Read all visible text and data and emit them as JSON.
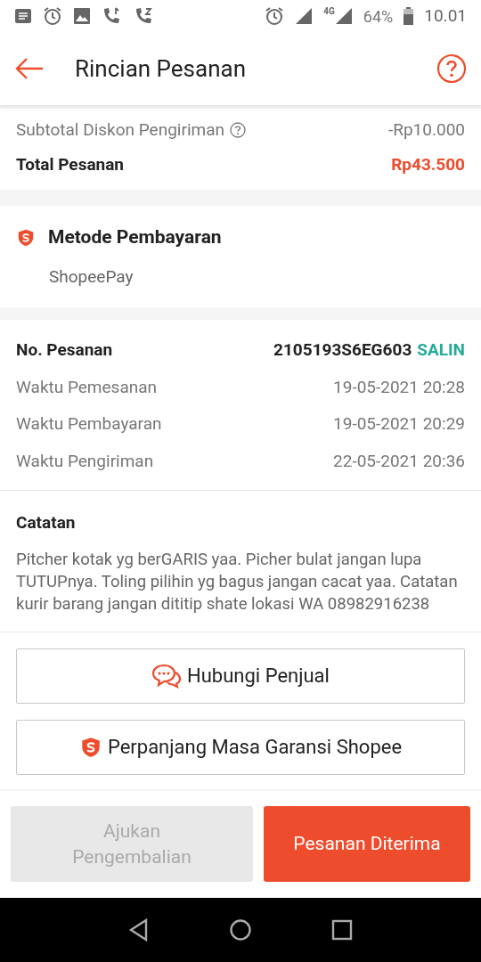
{
  "status_bar": {
    "network": "4G",
    "battery": "64%",
    "time": "10.01"
  },
  "header": {
    "title": "Rincian Pesanan"
  },
  "summary": [
    {
      "label": "Subtotal Diskon Pengiriman",
      "value": "-Rp10.000",
      "kind": "info"
    },
    {
      "label": "Total Pesanan",
      "value": "Rp43.500",
      "kind": "total"
    }
  ],
  "payment": {
    "title": "Metode Pembayaran",
    "method": "ShopeePay"
  },
  "order": {
    "number_label": "No. Pesanan",
    "number": "2105193S6EG603",
    "copy": "SALIN",
    "rows": [
      {
        "label": "Waktu Pemesanan",
        "value": "19-05-2021 20:28"
      },
      {
        "label": "Waktu Pembayaran",
        "value": "19-05-2021 20:29"
      },
      {
        "label": "Waktu Pengiriman",
        "value": "22-05-2021 20:36"
      }
    ]
  },
  "notes": {
    "title": "Catatan",
    "text": "Pitcher kotak yg berGARIS yaa. Picher bulat jangan lupa TUTUPnya. Toling pilihin yg bagus jangan cacat yaa. Catatan kurir barang jangan dititip shate lokasi WA 08982916238"
  },
  "actions": [
    {
      "label": "Hubungi Penjual",
      "kind": "chat"
    },
    {
      "label": "Perpanjang Masa Garansi Shopee",
      "kind": "shield"
    }
  ],
  "bottom_buttons": [
    {
      "label": "Ajukan Pengembalian",
      "disabled": true
    },
    {
      "label": "Pesanan Diterima",
      "disabled": false
    }
  ]
}
